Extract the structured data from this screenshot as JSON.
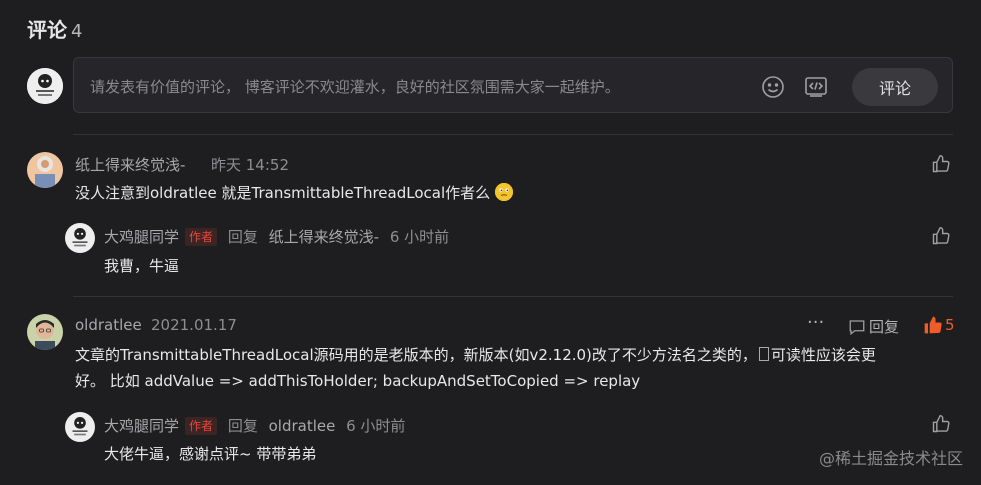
{
  "section": {
    "title": "评论",
    "count": "4"
  },
  "composer": {
    "placeholder": "请发表有价值的评论， 博客评论不欢迎灌水，良好的社区氛围需大家一起维护。",
    "submit_label": "评论"
  },
  "comments": [
    {
      "author": "纸上得来终觉浅-",
      "time": "昨天 14:52",
      "text": "没人注意到oldratlee 就是TransmittableThreadLocal作者么",
      "replies": [
        {
          "author": "大鸡腿同学",
          "badge": "作者",
          "reply_word": "回复",
          "reply_to": "纸上得来终觉浅-",
          "time": "6 小时前",
          "text": "我曹，牛逼"
        }
      ]
    },
    {
      "author": "oldratlee",
      "time": "2021.01.17",
      "more": "···",
      "reply_label": "回复",
      "likes": "5",
      "text_line1": "文章的TransmittableThreadLocal源码用的是老版本的，新版本(如v2.12.0)改了不少方法名之类的，",
      "text_line1b": "可读性应该会更",
      "text_line2": "好。 比如 addValue => addThisToHolder; backupAndSetToCopied => replay",
      "replies": [
        {
          "author": "大鸡腿同学",
          "badge": "作者",
          "reply_word": "回复",
          "reply_to": "oldratlee",
          "time": "6 小时前",
          "text": "大佬牛逼，感谢点评~ 带带弟弟"
        }
      ]
    }
  ],
  "watermark": "@稀土掘金技术社区"
}
